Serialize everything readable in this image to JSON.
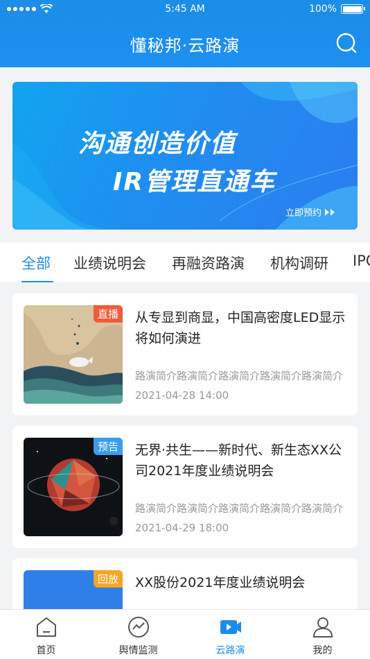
{
  "status_bar": {
    "time": "5:45 AM",
    "battery": "100%"
  },
  "header": {
    "title": "懂秘邦·云路演"
  },
  "banner": {
    "line1": "沟通创造价值",
    "line2": "IR管理直通车",
    "cta": "立即预约"
  },
  "tabs": [
    {
      "label": "全部",
      "active": true
    },
    {
      "label": "业绩说明会"
    },
    {
      "label": "再融资路演"
    },
    {
      "label": "机构调研"
    },
    {
      "label": "IPO"
    }
  ],
  "events": [
    {
      "badge": "直播",
      "badge_color": "#f15a3a",
      "title": "从专显到商显，中国高密度LED显示将如何演进",
      "desc": "路演简介路演简介路演简介路演简介路演简介",
      "date": "2021-04-28 14:00"
    },
    {
      "badge": "预告",
      "badge_color": "#3a9cf0",
      "title": "无界·共生——新时代、新生态XX公司2021年度业绩说明会",
      "desc": "路演简介路演简介路演简介路演简介路演简介",
      "date": "2021-04-29 18:00"
    },
    {
      "badge": "回放",
      "badge_color": "#f5a623",
      "title": "XX股份2021年度业绩说明会",
      "desc": "",
      "date": ""
    }
  ],
  "bottom_nav": [
    {
      "label": "首页",
      "icon": "home-icon"
    },
    {
      "label": "舆情监测",
      "icon": "trend-icon"
    },
    {
      "label": "云路演",
      "icon": "video-icon",
      "active": true
    },
    {
      "label": "我的",
      "icon": "user-icon"
    }
  ],
  "colors": {
    "primary": "#1a8ee8"
  }
}
